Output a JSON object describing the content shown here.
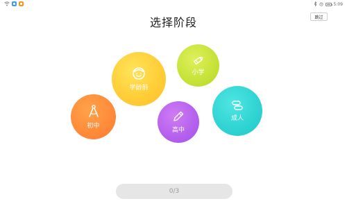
{
  "status_bar": {
    "time": "5:09",
    "left_icons": [
      "wifi-icon",
      "app-icon-blue",
      "app-icon-orange"
    ],
    "right_icons": [
      "bluetooth-icon",
      "alarm-icon",
      "battery-icon"
    ]
  },
  "header": {
    "title": "选择阶段",
    "skip_label": "跳过"
  },
  "stages": {
    "preschool": {
      "label": "学龄前",
      "icon": "smiley-face-icon",
      "color": "#FFCC35"
    },
    "primary": {
      "label": "小学",
      "icon": "crayon-icon",
      "color": "#C6E238"
    },
    "junior": {
      "label": "初中",
      "icon": "compass-icon",
      "color": "#FF8A3A"
    },
    "senior": {
      "label": "高中",
      "icon": "pencil-icon",
      "color": "#B460EE"
    },
    "adult": {
      "label": "成人",
      "icon": "books-icon",
      "color": "#2FD3D2"
    }
  },
  "footer": {
    "progress_text": "0/3"
  }
}
